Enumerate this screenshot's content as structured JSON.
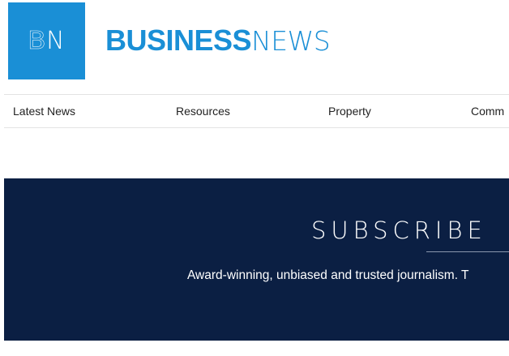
{
  "logo": {
    "box_text_b": "B",
    "box_text_n": "N",
    "brand_bold": "BUSINESS",
    "brand_light": "NEWS",
    "brand_color": "#1a8fd6"
  },
  "nav": {
    "items": [
      {
        "label": "Latest News"
      },
      {
        "label": "Resources"
      },
      {
        "label": "Property"
      },
      {
        "label": "Comm"
      }
    ]
  },
  "banner": {
    "title": "SUBSCRIBE",
    "tagline": "Award-winning, unbiased and trusted journalism. T",
    "background": "#0b1f43"
  }
}
